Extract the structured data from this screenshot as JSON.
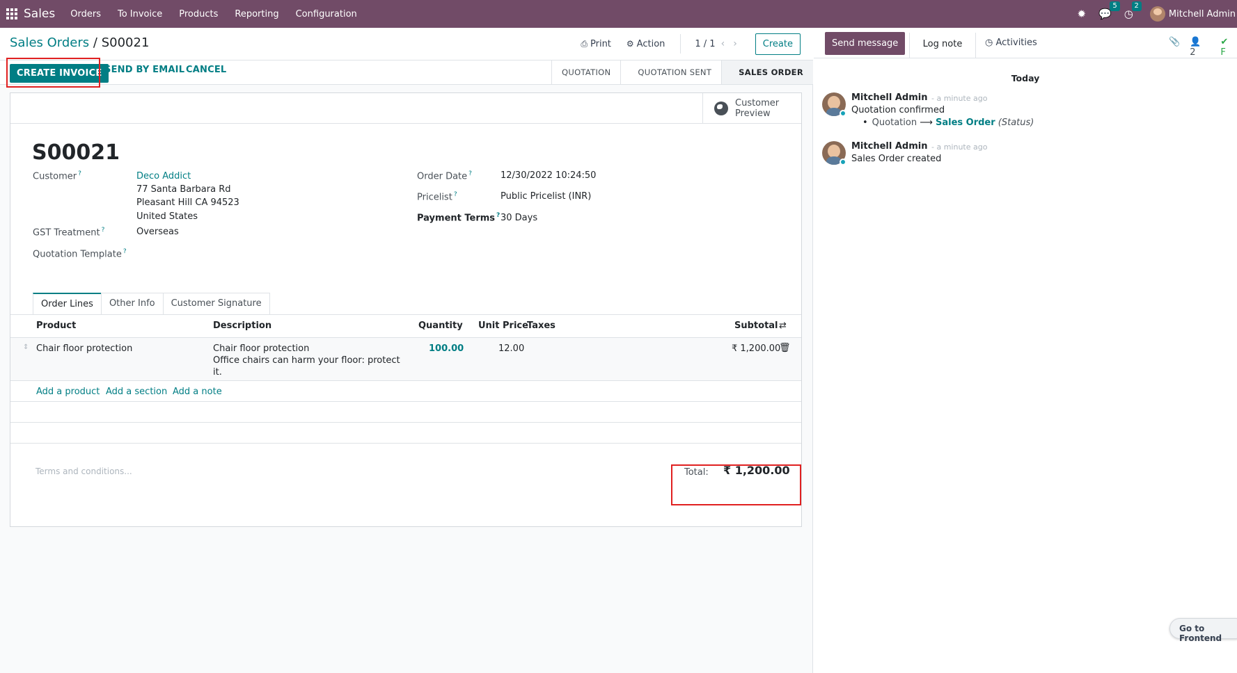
{
  "navbar": {
    "app_name": "Sales",
    "menu": [
      "Orders",
      "To Invoice",
      "Products",
      "Reporting",
      "Configuration"
    ],
    "messages_count": "5",
    "activities_count": "2",
    "user_name": "Mitchell Admin"
  },
  "control_panel": {
    "breadcrumb_parent": "Sales Orders",
    "breadcrumb_sep": "/",
    "breadcrumb_current": "S00021",
    "print_label": "Print",
    "action_label": "Action",
    "pager": "1 / 1",
    "create_label": "Create"
  },
  "statusbar": {
    "create_invoice": "CREATE INVOICE",
    "send_by_email": "SEND BY EMAIL",
    "cancel": "CANCEL",
    "stages": [
      "QUOTATION",
      "QUOTATION SENT",
      "SALES ORDER"
    ]
  },
  "form": {
    "preview_label": "Customer Preview",
    "title": "S00021",
    "customer_label": "Customer",
    "customer_name": "Deco Addict",
    "customer_address1": "77 Santa Barbara Rd",
    "customer_address2": "Pleasant Hill CA 94523",
    "customer_country": "United States",
    "gst_label": "GST Treatment",
    "gst_value": "Overseas",
    "template_label": "Quotation Template",
    "order_date_label": "Order Date",
    "order_date_value": "12/30/2022 10:24:50",
    "pricelist_label": "Pricelist",
    "pricelist_value": "Public Pricelist (INR)",
    "payment_terms_label": "Payment Terms",
    "payment_terms_value": "30 Days"
  },
  "tabs": [
    "Order Lines",
    "Other Info",
    "Customer Signature"
  ],
  "order_lines": {
    "headers": {
      "product": "Product",
      "description": "Description",
      "quantity": "Quantity",
      "unit_price": "Unit Price",
      "taxes": "Taxes",
      "subtotal": "Subtotal"
    },
    "row": {
      "product": "Chair floor protection",
      "desc1": "Chair floor protection",
      "desc2": "Office chairs can harm your floor: protect",
      "desc3": "it.",
      "quantity": "100.00",
      "unit_price": "12.00",
      "subtotal": "₹ 1,200.00"
    },
    "add_product": "Add a product",
    "add_section": "Add a section",
    "add_note": "Add a note"
  },
  "footer": {
    "terms_placeholder": "Terms and conditions...",
    "total_label": "Total:",
    "total_value": "₹ 1,200.00"
  },
  "chatter": {
    "send_message": "Send message",
    "log_note": "Log note",
    "activities": "Activities",
    "followers_count": "2",
    "follow_label": "F",
    "today": "Today",
    "messages": [
      {
        "author": "Mitchell Admin",
        "date": "- a minute ago",
        "body": "Quotation confirmed",
        "track_old": "Quotation",
        "track_new": "Sales Order",
        "track_field": "(Status)"
      },
      {
        "author": "Mitchell Admin",
        "date": "- a minute ago",
        "body": "Sales Order created"
      }
    ],
    "frontend_label": "Go to Frontend"
  },
  "colors": {
    "brand": "#714b67",
    "accent": "#017e84",
    "highlight": "#e02020"
  },
  "icons": [
    "apps-grid-icon",
    "bug-icon",
    "chat-icon",
    "clock-icon",
    "print-icon",
    "gear-icon",
    "chevron-left-icon",
    "chevron-right-icon",
    "globe-icon",
    "drag-handle-icon",
    "trash-icon",
    "column-settings-icon",
    "paperclip-icon",
    "user-icon",
    "check-icon"
  ]
}
